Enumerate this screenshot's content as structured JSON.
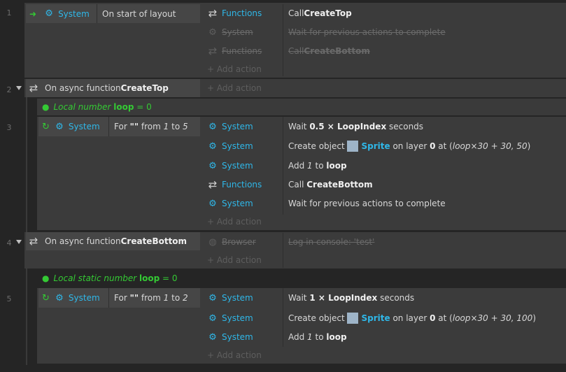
{
  "line_numbers": [
    "1",
    "2",
    "3",
    "4",
    "5"
  ],
  "e1": {
    "cond_object": "System",
    "cond_text": "On start of layout",
    "actions": [
      {
        "object": "Functions",
        "pre": "Call ",
        "bold": "CreateTop",
        "post": "",
        "disabled": false
      },
      {
        "object": "System",
        "pre": "Wait for previous actions to complete",
        "bold": "",
        "post": "",
        "disabled": true
      },
      {
        "object": "Functions",
        "pre": "Call ",
        "bold": "CreateBottom",
        "post": "",
        "disabled": true
      }
    ],
    "add_action": "+ Add action"
  },
  "e2": {
    "cond_pre": "On async function ",
    "cond_bold": "CreateTop",
    "add_action": "+ Add action",
    "var": {
      "pre": "Local number ",
      "name": "loop",
      "post": " = 0"
    }
  },
  "e3": {
    "cond_object": "System",
    "cond_pre": "For ",
    "cond_str": "\"\"",
    "cond_mid": " from ",
    "cond_a": "1",
    "cond_to": " to ",
    "cond_b": "5",
    "actions": [
      {
        "object": "System",
        "a": "Wait ",
        "b": "0.5 × LoopIndex",
        "c": " seconds"
      },
      {
        "object": "System",
        "a": "Create object ",
        "sprite": "Sprite",
        "c": " on layer ",
        "layer": "0",
        "d": " at (",
        "e": "loop×30 + 30, 50",
        "f": ")"
      },
      {
        "object": "System",
        "a": "Add ",
        "n": "1",
        "c": " to ",
        "b": "loop"
      },
      {
        "object": "Functions",
        "a": "Call ",
        "b": "CreateBottom"
      },
      {
        "object": "System",
        "a": "Wait for previous actions to complete"
      }
    ],
    "add_action": "+ Add action"
  },
  "e4": {
    "cond_pre": "On async function ",
    "cond_bold": "CreateBottom",
    "action": {
      "object": "Browser",
      "text": "Log in console: 'test'"
    },
    "add_action": "+ Add action",
    "var": {
      "pre": "Local static number ",
      "name": "loop",
      "post": " = 0"
    }
  },
  "e5": {
    "cond_object": "System",
    "cond_pre": "For ",
    "cond_str": "\"\"",
    "cond_mid": " from ",
    "cond_a": "1",
    "cond_to": " to ",
    "cond_b": "2",
    "actions": [
      {
        "object": "System",
        "a": "Wait ",
        "b": "1 × LoopIndex",
        "c": " seconds"
      },
      {
        "object": "System",
        "a": "Create object ",
        "sprite": "Sprite",
        "c": " on layer ",
        "layer": "0",
        "d": " at (",
        "e": "loop×30 + 30, 100",
        "f": ")"
      },
      {
        "object": "System",
        "a": "Add ",
        "n": "1",
        "c": " to ",
        "b": "loop"
      }
    ],
    "add_action": "+ Add action"
  },
  "colors": {
    "accent": "#2fb7e8",
    "variable": "#34c934",
    "background": "#252525",
    "block": "#3b3b3b",
    "condition": "#464646"
  }
}
